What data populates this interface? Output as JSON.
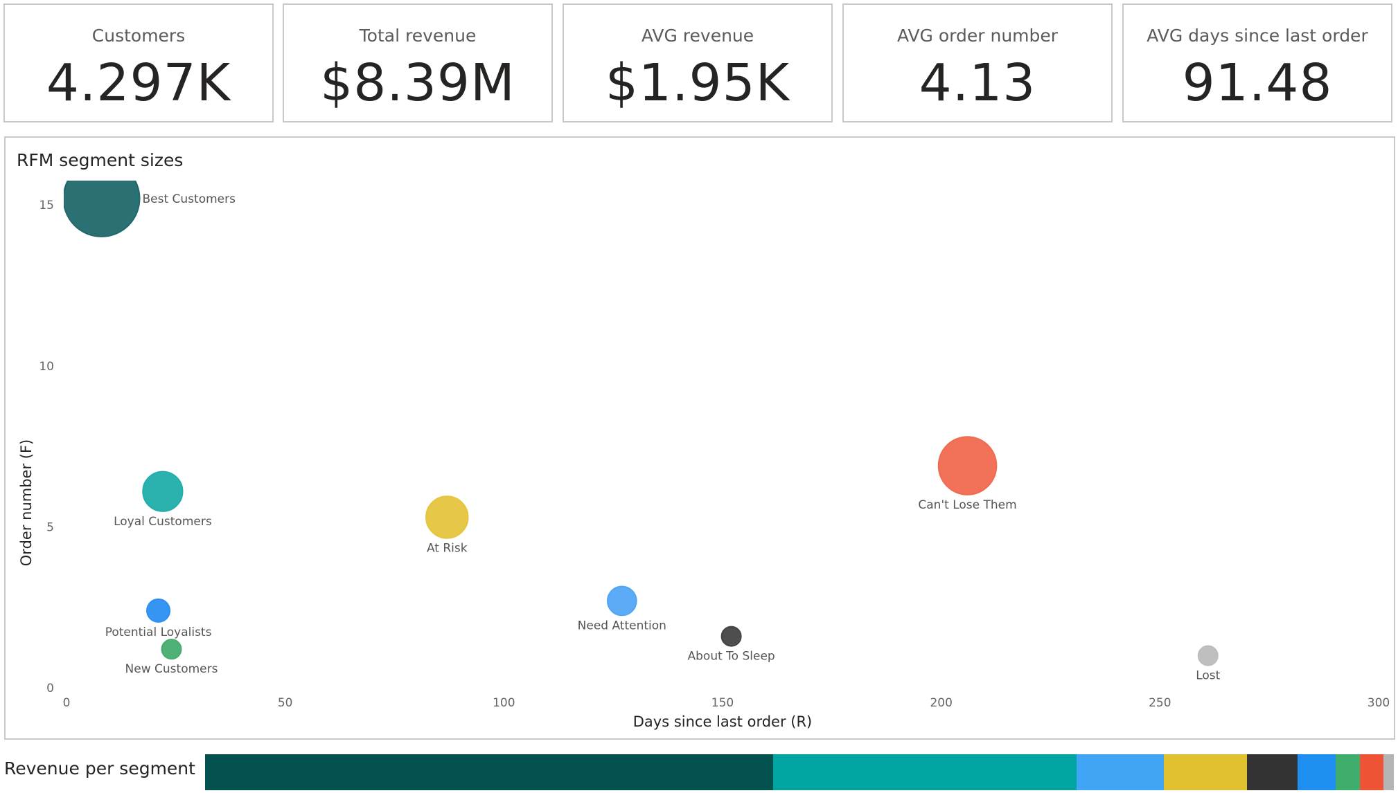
{
  "kpis": [
    {
      "label": "Customers",
      "value": "4.297K"
    },
    {
      "label": "Total revenue",
      "value": "$8.39M"
    },
    {
      "label": "AVG revenue",
      "value": "$1.95K"
    },
    {
      "label": "AVG order number",
      "value": "4.13"
    },
    {
      "label": "AVG days since last order",
      "value": "91.48"
    }
  ],
  "chart_data": [
    {
      "type": "scatter",
      "title": "RFM segment sizes",
      "xlabel": "Days since last order (R)",
      "ylabel": "Order number (F)",
      "xlim": [
        0,
        300
      ],
      "ylim": [
        0,
        15.8
      ],
      "xticks": [
        0,
        50,
        100,
        150,
        200,
        250,
        300
      ],
      "yticks": [
        0,
        5,
        10,
        15
      ],
      "grid": false,
      "points": [
        {
          "name": "Best Customers",
          "x": 8,
          "y": 15.2,
          "size": 1.0,
          "color": "#20686a"
        },
        {
          "name": "Loyal Customers",
          "x": 22,
          "y": 6.1,
          "size": 0.52,
          "color": "#21aeaa"
        },
        {
          "name": "At Risk",
          "x": 87,
          "y": 5.3,
          "size": 0.55,
          "color": "#e5c43e"
        },
        {
          "name": "Can't Lose Them",
          "x": 206,
          "y": 6.9,
          "size": 0.76,
          "color": "#f06a4f"
        },
        {
          "name": "Need Attention",
          "x": 127,
          "y": 2.7,
          "size": 0.38,
          "color": "#52a7f5"
        },
        {
          "name": "Potential Loyalists",
          "x": 21,
          "y": 2.4,
          "size": 0.3,
          "color": "#2b8ff2"
        },
        {
          "name": "New Customers",
          "x": 24,
          "y": 1.2,
          "size": 0.22,
          "color": "#46ad6e"
        },
        {
          "name": "About To Sleep",
          "x": 152,
          "y": 1.6,
          "size": 0.23,
          "color": "#444444"
        },
        {
          "name": "Lost",
          "x": 261,
          "y": 1.0,
          "size": 0.18,
          "color": "#bcbcbc"
        }
      ]
    },
    {
      "type": "bar",
      "title": "Revenue per segment",
      "orientation": "horizontal-stacked-100",
      "segments": [
        {
          "value": 37.1,
          "color": "#03524f"
        },
        {
          "value": 19.8,
          "color": "#00a5a2"
        },
        {
          "value": 5.7,
          "color": "#41a5f5"
        },
        {
          "value": 5.4,
          "color": "#e1c130"
        },
        {
          "value": 3.3,
          "color": "#333333"
        },
        {
          "value": 2.5,
          "color": "#1e8ff1"
        },
        {
          "value": 1.6,
          "color": "#3fad6c"
        },
        {
          "value": 1.5,
          "color": "#ee5335"
        },
        {
          "value": 0.7,
          "color": "#b5b5b5"
        }
      ]
    }
  ]
}
